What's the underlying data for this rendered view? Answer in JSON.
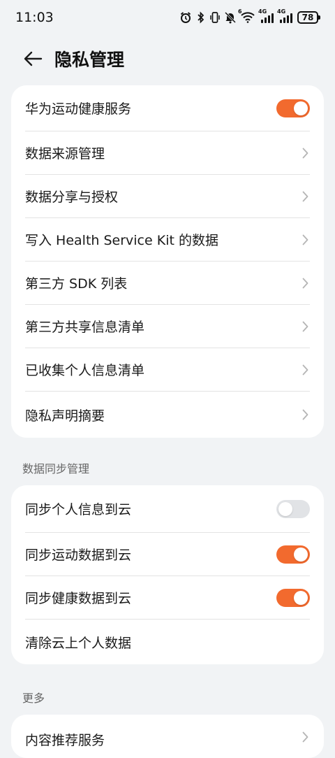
{
  "status_bar": {
    "time": "11:03",
    "network_a": "4G",
    "network_b": "4G",
    "wifi_label": "6",
    "battery": "78",
    "icons": [
      "alarm-icon",
      "bluetooth-icon",
      "vibrate-icon",
      "mute-icon",
      "wifi-icon",
      "signal-icon",
      "signal-icon",
      "battery-icon"
    ]
  },
  "header": {
    "title": "隐私管理"
  },
  "colors": {
    "accent": "#f26a2e",
    "toggle_off": "#e1e3e6",
    "background": "#f1f3f5"
  },
  "privacy_card": {
    "items": [
      {
        "label": "华为运动健康服务",
        "control": "toggle",
        "on": true
      },
      {
        "label": "数据来源管理",
        "control": "chevron"
      },
      {
        "label": "数据分享与授权",
        "control": "chevron"
      },
      {
        "label": "写入 Health Service Kit 的数据",
        "control": "chevron"
      },
      {
        "label": "第三方 SDK 列表",
        "control": "chevron"
      },
      {
        "label": "第三方共享信息清单",
        "control": "chevron"
      },
      {
        "label": "已收集个人信息清单",
        "control": "chevron"
      },
      {
        "label": "隐私声明摘要",
        "control": "chevron"
      }
    ]
  },
  "sync_section": {
    "title": "数据同步管理",
    "items": [
      {
        "label": "同步个人信息到云",
        "control": "toggle",
        "on": false
      },
      {
        "label": "同步运动数据到云",
        "control": "toggle",
        "on": true
      },
      {
        "label": "同步健康数据到云",
        "control": "toggle",
        "on": true
      },
      {
        "label": "清除云上个人数据",
        "control": "none"
      }
    ]
  },
  "more_section": {
    "title": "更多",
    "items": [
      {
        "label": "内容推荐服务",
        "control": "chevron"
      }
    ]
  }
}
